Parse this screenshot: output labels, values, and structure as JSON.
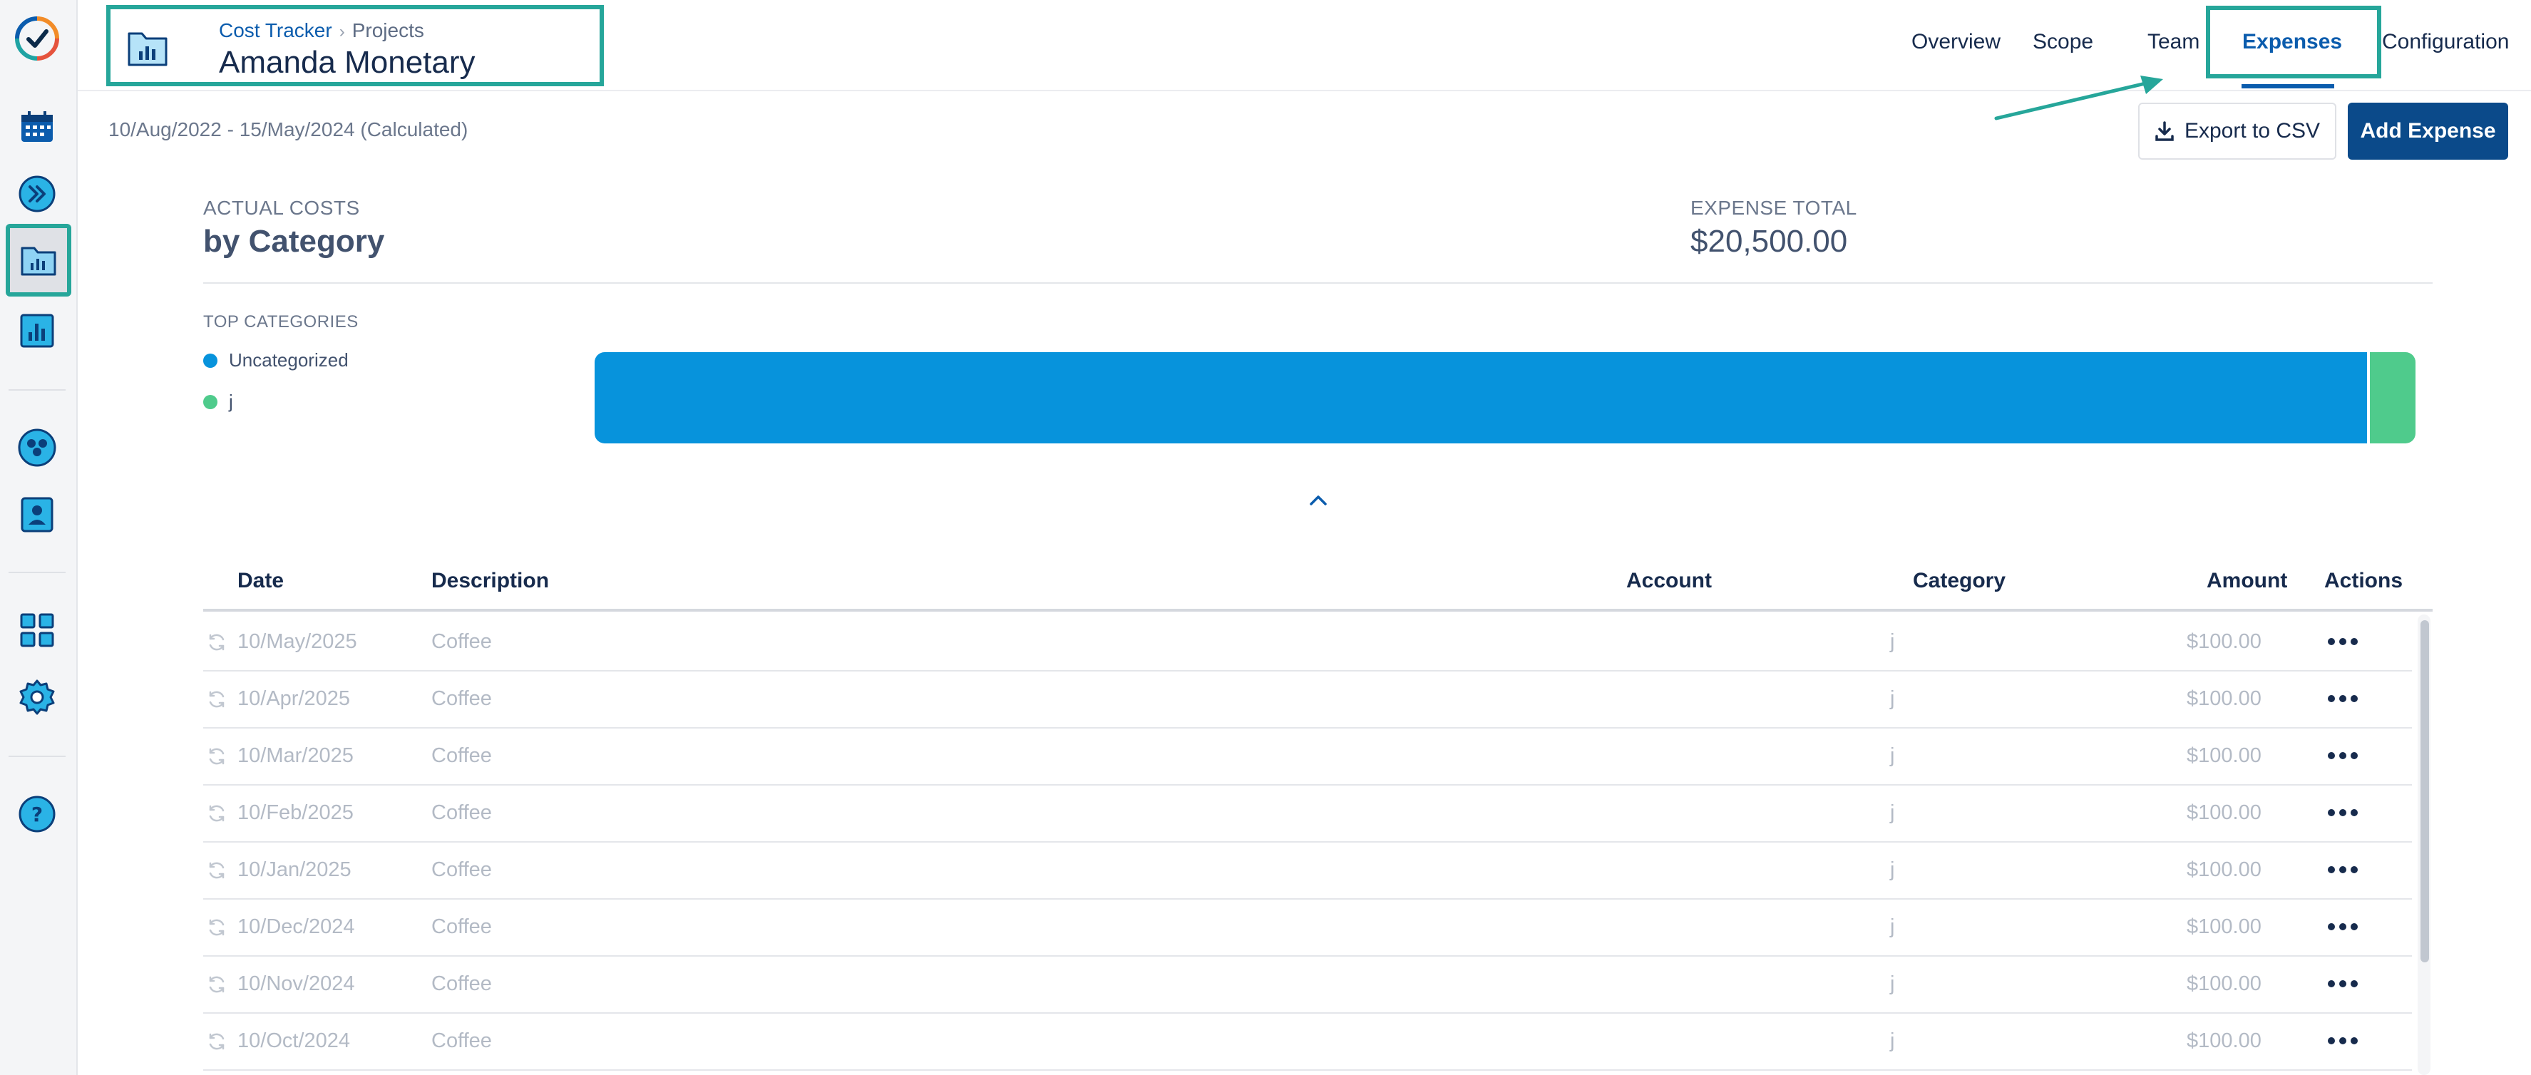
{
  "rail": {
    "icons": [
      "app-logo-icon",
      "calendar-icon",
      "fast-forward-icon",
      "cost-tracker-folder-icon",
      "report-chart-icon",
      "teams-icon",
      "user-profile-icon",
      "dashboard-grid-icon",
      "settings-gear-icon",
      "help-icon"
    ],
    "brand_blue": "#0b5cad",
    "highlight": "#26a69a"
  },
  "header": {
    "breadcrumb": {
      "root": "Cost Tracker",
      "current": "Projects"
    },
    "title": "Amanda Monetary",
    "tabs": [
      {
        "label": "Overview",
        "active": false
      },
      {
        "label": "Scope",
        "active": false
      },
      {
        "label": "Team",
        "active": false
      },
      {
        "label": "Expenses",
        "active": true
      },
      {
        "label": "Configuration",
        "active": false
      }
    ]
  },
  "toolbar": {
    "date_range": "10/Aug/2022 - 15/May/2024 (Calculated)",
    "export_label": "Export to CSV",
    "add_label": "Add Expense"
  },
  "summary": {
    "actual_costs_label": "ACTUAL COSTS",
    "by_label": "by Category",
    "expense_total_label": "EXPENSE TOTAL",
    "expense_total": "$20,500.00",
    "top_categories_label": "TOP CATEGORIES",
    "categories": [
      {
        "name": "Uncategorized",
        "color": "#0793dc",
        "share": 0.975
      },
      {
        "name": "j",
        "color": "#4fcb8c",
        "share": 0.025
      }
    ]
  },
  "table": {
    "columns": {
      "date": "Date",
      "description": "Description",
      "account": "Account",
      "category": "Category",
      "amount": "Amount",
      "actions": "Actions"
    },
    "rows": [
      {
        "date": "10/May/2025",
        "description": "Coffee",
        "account": "",
        "category": "j",
        "amount": "$100.00"
      },
      {
        "date": "10/Apr/2025",
        "description": "Coffee",
        "account": "",
        "category": "j",
        "amount": "$100.00"
      },
      {
        "date": "10/Mar/2025",
        "description": "Coffee",
        "account": "",
        "category": "j",
        "amount": "$100.00"
      },
      {
        "date": "10/Feb/2025",
        "description": "Coffee",
        "account": "",
        "category": "j",
        "amount": "$100.00"
      },
      {
        "date": "10/Jan/2025",
        "description": "Coffee",
        "account": "",
        "category": "j",
        "amount": "$100.00"
      },
      {
        "date": "10/Dec/2024",
        "description": "Coffee",
        "account": "",
        "category": "j",
        "amount": "$100.00"
      },
      {
        "date": "10/Nov/2024",
        "description": "Coffee",
        "account": "",
        "category": "j",
        "amount": "$100.00"
      },
      {
        "date": "10/Oct/2024",
        "description": "Coffee",
        "account": "",
        "category": "j",
        "amount": "$100.00"
      }
    ]
  }
}
